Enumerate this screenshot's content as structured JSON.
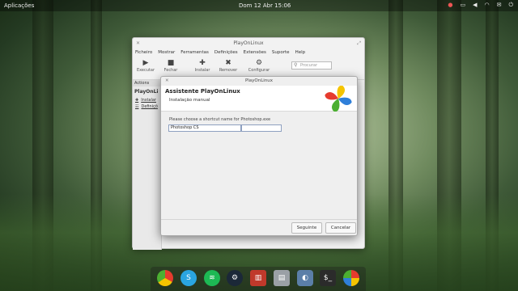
{
  "panel": {
    "apps_label": "Aplicações",
    "clock": "Dom 12 Abr  15:06"
  },
  "main_window": {
    "title": "PlayOnLinux",
    "menu": [
      "Ficheiro",
      "Mostrar",
      "Ferramentas",
      "Definições",
      "Extensões",
      "Suporte",
      "Help"
    ],
    "toolbar": {
      "run": "Executar",
      "close": "Fechar",
      "install": "Instalar",
      "remove": "Remover",
      "configure": "Configurar"
    },
    "search_placeholder": "Procurar",
    "sidebar": {
      "header": "Actions",
      "group": "PlayOnLi",
      "items": [
        "Instalar",
        "Definiçõ"
      ]
    }
  },
  "dialog": {
    "title": "PlayOnLinux",
    "heading": "Assistente PlayOnLinux",
    "subheading": "Instalação manual",
    "prompt": "Please choose a shortcut name for Photoshop.exe",
    "field_value": "Photoshop CS",
    "next_button": "Seguinte",
    "cancel_button": "Cancelar"
  },
  "dock": {
    "icons": [
      "chrome-icon",
      "skype-icon",
      "spotify-icon",
      "steam-icon",
      "popcorn-icon",
      "files-icon",
      "settings-toggle-icon",
      "terminal-icon",
      "playonlinux-icon"
    ]
  },
  "colors": {
    "accent_blue": "#8ea0c0",
    "pol_red": "#e63b2e",
    "pol_green": "#4caf32",
    "pol_yellow": "#f5c400",
    "pol_blue": "#2f7fd9"
  }
}
